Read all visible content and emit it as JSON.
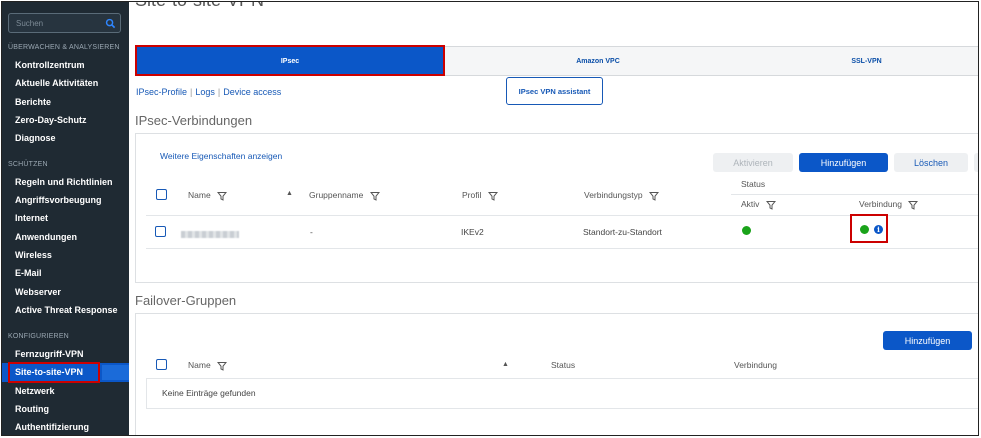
{
  "search": {
    "placeholder": "Suchen",
    "icon": "search-icon"
  },
  "sidebar": {
    "sections": [
      {
        "label": "ÜBERWACHEN & ANALYSIEREN"
      },
      {
        "label": "SCHÜTZEN"
      },
      {
        "label": "KONFIGURIEREN"
      }
    ],
    "items": [
      "Kontrollzentrum",
      "Aktuelle Aktivitäten",
      "Berichte",
      "Zero-Day-Schutz",
      "Diagnose",
      "Regeln und Richtlinien",
      "Angriffsvorbeugung",
      "Internet",
      "Anwendungen",
      "Wireless",
      "E-Mail",
      "Webserver",
      "Active Threat Response",
      "Fernzugriff-VPN",
      "Site-to-site-VPN",
      "Netzwerk",
      "Routing",
      "Authentifizierung"
    ],
    "active_item": "Site-to-site-VPN"
  },
  "page": {
    "title": "Site-to-site-VPN"
  },
  "tabs": [
    "IPsec",
    "Amazon VPC",
    "SSL-VPN"
  ],
  "sublinks": [
    "IPsec-Profile",
    "Logs",
    "Device access"
  ],
  "assistant_label": "IPsec VPN assistant",
  "connections": {
    "heading": "IPsec-Verbindungen",
    "more_link": "Weitere Eigenschaften anzeigen",
    "buttons": {
      "activate": "Aktivieren",
      "add": "Hinzufügen",
      "delete": "Löschen"
    },
    "columns": {
      "name": "Name",
      "group": "Gruppenname",
      "profile": "Profil",
      "type": "Verbindungstyp",
      "status": "Status",
      "active": "Aktiv",
      "connection": "Verbindung"
    },
    "rows": [
      {
        "name": "(blurred)",
        "group": "-",
        "profile": "IKEv2",
        "type": "Standort-zu-Standort",
        "active": "green",
        "connection": "green"
      }
    ]
  },
  "failover": {
    "heading": "Failover-Gruppen",
    "add": "Hinzufügen",
    "columns": {
      "name": "Name",
      "status": "Status",
      "connection": "Verbindung"
    },
    "empty": "Keine Einträge gefunden"
  },
  "colors": {
    "accent": "#0b57c8",
    "sidebar": "#1f2a33",
    "status_ok": "#1aa31a",
    "highlight": "#cc0000"
  }
}
